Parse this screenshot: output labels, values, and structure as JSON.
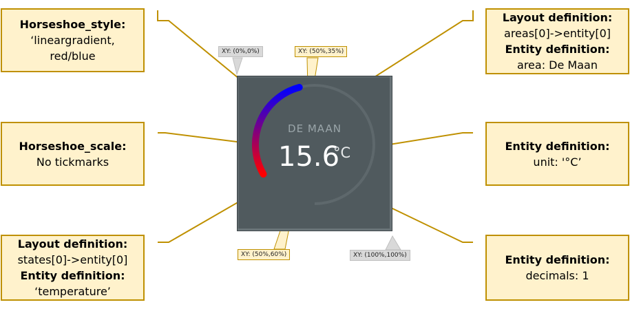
{
  "callouts": {
    "horseshoe_style": {
      "title": "Horseshoe_style:",
      "line1": "‘lineargradient,",
      "line2": "red/blue"
    },
    "horseshoe_scale": {
      "title": "Horseshoe_scale:",
      "line1": "No tickmarks"
    },
    "layout_states": {
      "title": "Layout definition:",
      "line1": "states[0]->entity[0]",
      "title2": "Entity definition:",
      "line2": "‘temperature’"
    },
    "layout_areas": {
      "title": "Layout definition:",
      "line1": "areas[0]->entity[0]",
      "title2": "Entity definition:",
      "line2": "area: De Maan"
    },
    "entity_unit": {
      "title": "Entity definition:",
      "line1": "unit: '°C’"
    },
    "entity_decimals": {
      "title": "Entity definition:",
      "line1": "decimals: 1"
    }
  },
  "card": {
    "area_name": "DE MAAN",
    "value": "15.6",
    "unit": "°C",
    "gauge_fraction": 0.35,
    "gradient": {
      "start": "#ff0000",
      "end": "#0000ff"
    },
    "track_color": "#5e686c"
  },
  "xy_labels": {
    "top_left": "XY: (0%,0%)",
    "area": "XY: (50%,35%)",
    "state": "XY: (50%,60%)",
    "bottom_right": "XY: (100%,100%)"
  },
  "colors": {
    "callout_fill": "#fff2cc",
    "callout_border": "#bf9000",
    "card_background": "#505a5e"
  }
}
